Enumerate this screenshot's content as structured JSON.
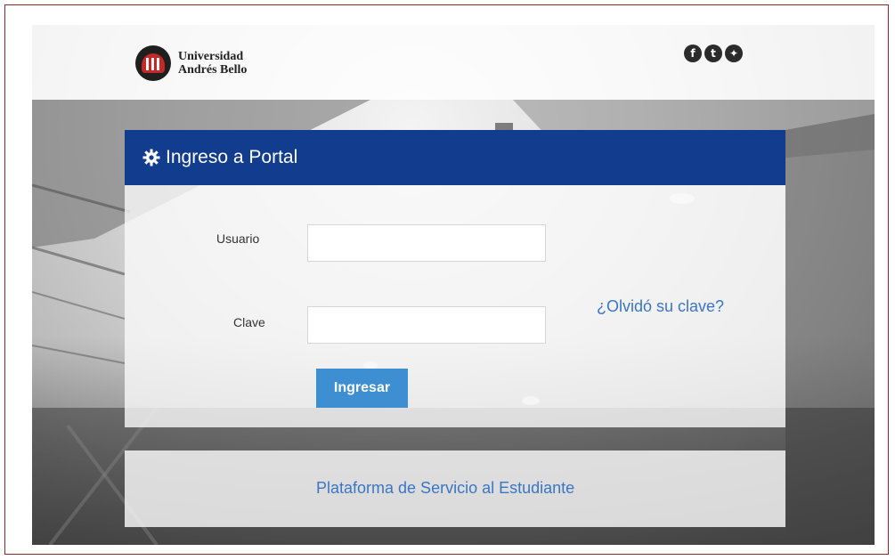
{
  "header": {
    "logo_line1": "Universidad",
    "logo_line2": "Andrés Bello",
    "social": [
      {
        "icon": "facebook-icon",
        "glyph": "f"
      },
      {
        "icon": "twitter-icon",
        "glyph": "t"
      },
      {
        "icon": "globe-icon",
        "glyph": "✦"
      }
    ]
  },
  "login": {
    "title": "Ingreso a Portal",
    "user_label": "Usuario",
    "user_value": "",
    "password_label": "Clave",
    "password_value": "",
    "forgot_link": "¿Olvidó su clave?",
    "submit_label": "Ingresar"
  },
  "footer": {
    "link": "Plataforma de Servicio al Estudiante"
  },
  "colors": {
    "header_blue": "#123c8d",
    "button_blue": "#3d8fd2",
    "link_blue": "#3a76c4",
    "frame_border": "#8a2a2a"
  }
}
